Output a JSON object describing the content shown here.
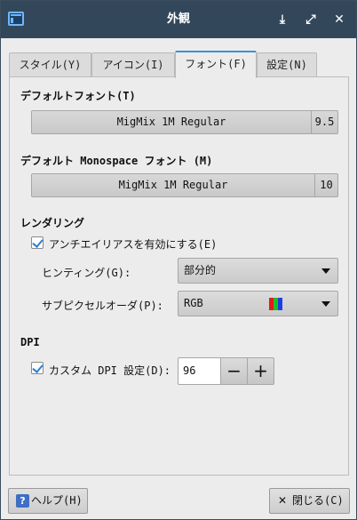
{
  "window": {
    "title": "外観"
  },
  "titlebar_buttons": {
    "minimize": "⤓",
    "maximize": "⤢",
    "close": "✕"
  },
  "tabs": [
    {
      "label": "スタイル(Y)",
      "active": false
    },
    {
      "label": "アイコン(I)",
      "active": false
    },
    {
      "label": "フォント(F)",
      "active": true
    },
    {
      "label": "設定(N)",
      "active": false
    }
  ],
  "default_font": {
    "heading": "デフォルトフォント(T)",
    "name": "MigMix 1M Regular",
    "size": "9.5"
  },
  "mono_font": {
    "heading": "デフォルト Monospace フォント (M)",
    "name": "MigMix 1M Regular",
    "size": "10"
  },
  "rendering": {
    "heading": "レンダリング",
    "antialias_label": "アンチエイリアスを有効にする(E)",
    "antialias_checked": true,
    "hinting_label": "ヒンティング(G):",
    "hinting_value": "部分的",
    "subpixel_label": "サブピクセルオーダ(P):",
    "subpixel_value": "RGB",
    "rgb_colors": [
      "#e01b1b",
      "#1fbf1f",
      "#1e3fe0"
    ]
  },
  "dpi": {
    "heading": "DPI",
    "custom_label": "カスタム DPI 設定(D):",
    "custom_checked": true,
    "value": "96",
    "minus": "−",
    "plus": "+"
  },
  "footer": {
    "help_icon": "?",
    "help_label": "ヘルプ(H)",
    "close_icon": "✕",
    "close_label": "閉じる(C)"
  }
}
